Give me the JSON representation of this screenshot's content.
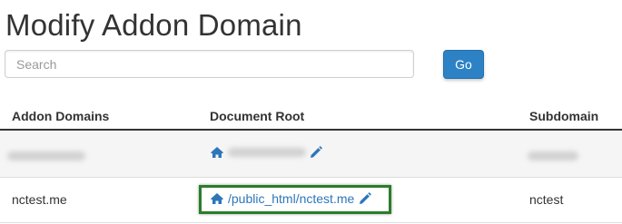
{
  "page": {
    "title": "Modify Addon Domain"
  },
  "search": {
    "placeholder": "Search",
    "value": "",
    "go_label": "Go"
  },
  "table": {
    "columns": [
      "Addon Domains",
      "Document Root",
      "Subdomain"
    ],
    "rows": [
      {
        "addon_domain": "",
        "document_root": "",
        "subdomain": "",
        "redacted": true
      },
      {
        "addon_domain": "nctest.me",
        "document_root": "/public_html/nctest.me",
        "subdomain": "nctest",
        "redacted": false
      }
    ]
  },
  "icons": {
    "home": "home-icon",
    "edit": "pencil-icon"
  },
  "colors": {
    "accent": "#2d82c6",
    "link": "#2d77b8",
    "highlight_border": "#2a7d2a"
  }
}
